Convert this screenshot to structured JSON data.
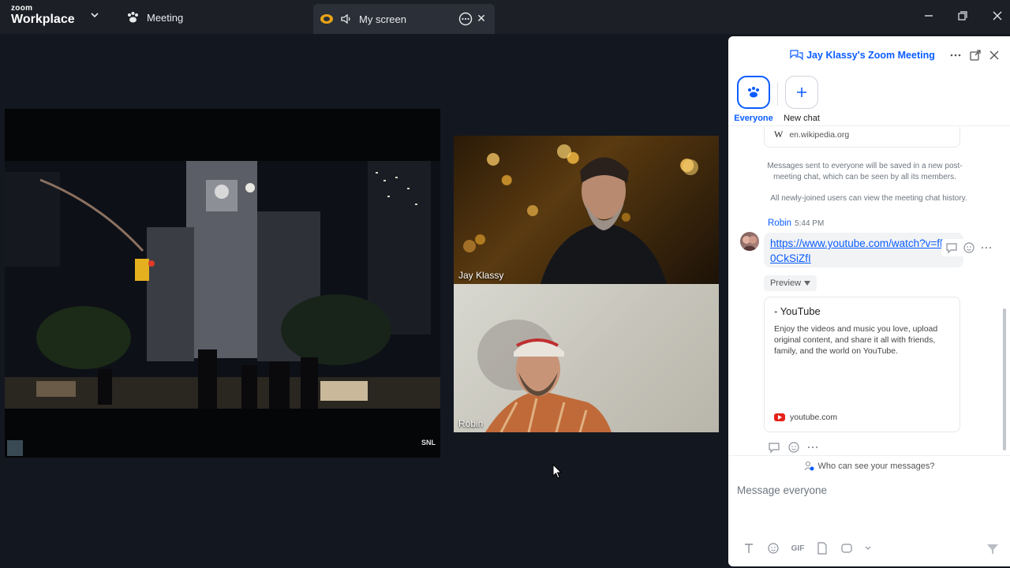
{
  "titlebar": {
    "brand_top": "zoom",
    "brand_bottom": "Workplace",
    "tabs": [
      {
        "label": "Meeting",
        "icon": "meeting-paw-icon"
      },
      {
        "label": "My screen",
        "icon": "screen-share-icon"
      }
    ]
  },
  "videos": {
    "participants": [
      {
        "name": "Jay Klassy"
      },
      {
        "name": "Robin"
      }
    ],
    "main_watermark": "SNL"
  },
  "chat": {
    "title": "Jay Klassy's Zoom Meeting",
    "tabs": [
      {
        "label": "Everyone",
        "active": true
      },
      {
        "label": "New chat",
        "active": false
      }
    ],
    "earlier_link_site": "en.wikipedia.org",
    "system_messages": [
      "Messages sent to everyone will be saved in a new post-meeting chat, which can be seen by all its members.",
      "All newly-joined users can view the meeting chat history."
    ],
    "message": {
      "sender": "Robin",
      "time": "5:44 PM",
      "text": "https://www.youtube.com/watch?v=fFO0CkSiZfI",
      "preview_toggle": "Preview",
      "preview": {
        "title": "- YouTube",
        "description": "Enjoy the videos and music you love, upload original content, and share it all with friends, family, and the world on YouTube.",
        "site": "youtube.com"
      }
    },
    "visibility_prompt": "Who can see your messages?",
    "compose_placeholder": "Message everyone",
    "toolbar": {
      "gif_label": "GIF"
    }
  },
  "colors": {
    "accent": "#0b5cff",
    "app_bg": "#131720",
    "titlebar_bg": "#1c1f26",
    "youtube_red": "#e62117"
  }
}
